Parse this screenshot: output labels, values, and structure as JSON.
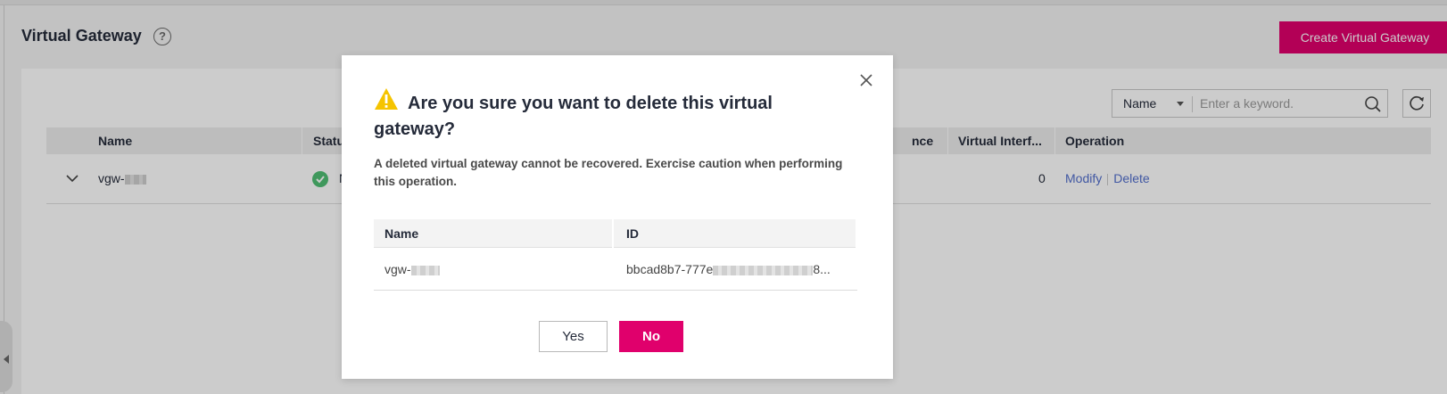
{
  "page": {
    "title": "Virtual Gateway",
    "create_button": "Create Virtual Gateway"
  },
  "filter": {
    "field": "Name",
    "placeholder": "Enter a keyword."
  },
  "table": {
    "columns": [
      "Name",
      "Statu",
      "nce",
      "Virtual Interf...",
      "Operation"
    ],
    "rows": [
      {
        "name": "vgw-",
        "status": "N",
        "virtual_interfaces": "0",
        "op_modify": "Modify",
        "op_delete": "Delete"
      }
    ]
  },
  "dialog": {
    "title": "Are you sure you want to delete this virtual gateway?",
    "description": "A deleted virtual gateway cannot be recovered. Exercise caution when performing this operation.",
    "columns": [
      "Name",
      "ID"
    ],
    "rows": [
      {
        "name": "vgw-",
        "id_start": "bbcad8b7-777e",
        "id_end": "8..."
      }
    ],
    "yes_label": "Yes",
    "no_label": "No"
  },
  "colors": {
    "accent": "#e0006c",
    "link": "#526ecc",
    "warning": "#f5c400",
    "success": "#4fbf74"
  },
  "icons": [
    "help-icon",
    "search-icon",
    "refresh-icon",
    "chevron-down-icon",
    "success-icon",
    "warning-icon",
    "close-icon",
    "collapse-arrow-icon"
  ]
}
